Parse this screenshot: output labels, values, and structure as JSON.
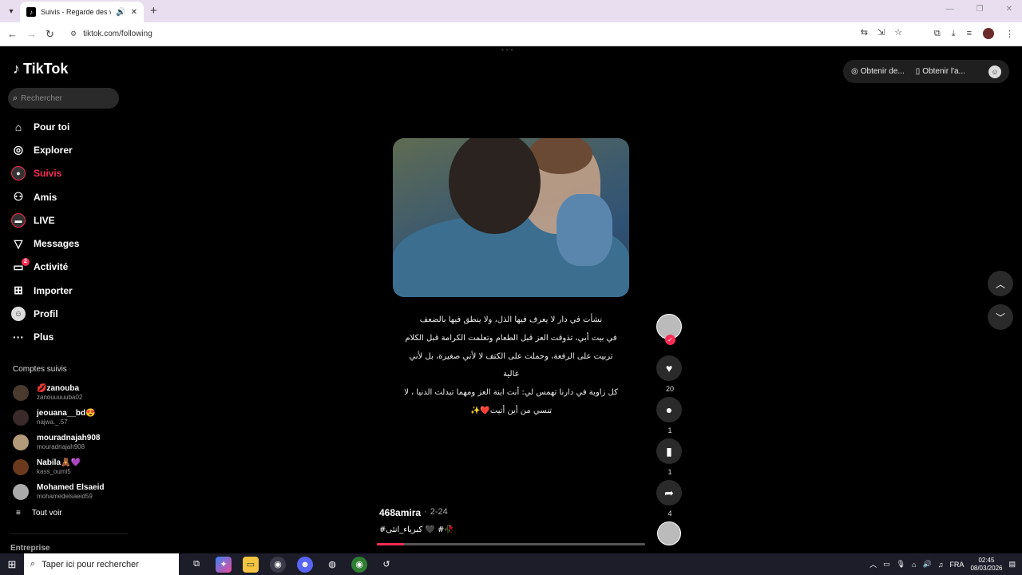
{
  "browser": {
    "tab_title": "Suivis - Regarde des vidéos",
    "url": "tiktok.com/following",
    "new_tab_label": "+"
  },
  "app": {
    "logo_text": "TikTok",
    "search_placeholder": "Rechercher"
  },
  "sidebar": {
    "items": [
      {
        "label": "Pour toi",
        "icon": "home-icon"
      },
      {
        "label": "Explorer",
        "icon": "compass-icon"
      },
      {
        "label": "Suivis",
        "icon": "following-icon",
        "active": true
      },
      {
        "label": "Amis",
        "icon": "friends-icon"
      },
      {
        "label": "LIVE",
        "icon": "live-icon"
      },
      {
        "label": "Messages",
        "icon": "messages-icon"
      },
      {
        "label": "Activité",
        "icon": "activity-icon",
        "badge": "2"
      },
      {
        "label": "Importer",
        "icon": "upload-icon"
      },
      {
        "label": "Profil",
        "icon": "profile-icon"
      },
      {
        "label": "Plus",
        "icon": "more-icon"
      }
    ],
    "followed_title": "Comptes suivis",
    "followed": [
      {
        "name": "💋zanouba",
        "user": "zanouuuuuba02"
      },
      {
        "name": "jeouana__bd😍",
        "user": "najwa._.57"
      },
      {
        "name": "mouradnajah908",
        "user": "mouradnajah908"
      },
      {
        "name": "Nabila🧸💜",
        "user": "kass_oumi5"
      },
      {
        "name": "Mohamed Elsaeid",
        "user": "mohamedelsaeid59"
      }
    ],
    "see_all": "Tout voir",
    "enterprise": "Entreprise"
  },
  "top_actions": {
    "get_coins": "Obtenir de...",
    "get_app": "Obtenir l'a..."
  },
  "post": {
    "caption_lines": [
      "نشأت في دار لا يعرف فيها الذل، ولا ينطق فيها بالضعف",
      "في بيت أبي، تذوقت العز قبل الطعام وتعلمت الكرامة قبل الكلام",
      "تربيت على الرفعة، وحملت على الكتف لا لأني صغيرة، بل لأني",
      "غالية",
      "كل زاوية في دارنا تهمس لي: أنت ابنة العز ومهما تبدلت الدنيا ، لا",
      "تنسي من أين أتيت❤️✨"
    ],
    "author": "468amira",
    "date": "2-24",
    "hashtags": "#كبرياء_انثى 🖤 #🥀",
    "progress": 0.1,
    "likes": "20",
    "comments": "1",
    "saves": "1",
    "shares": "4"
  },
  "taskbar": {
    "search_placeholder": "Taper ici pour rechercher",
    "lang": "FRA",
    "time": "02:45",
    "date": "08/03/2026"
  }
}
